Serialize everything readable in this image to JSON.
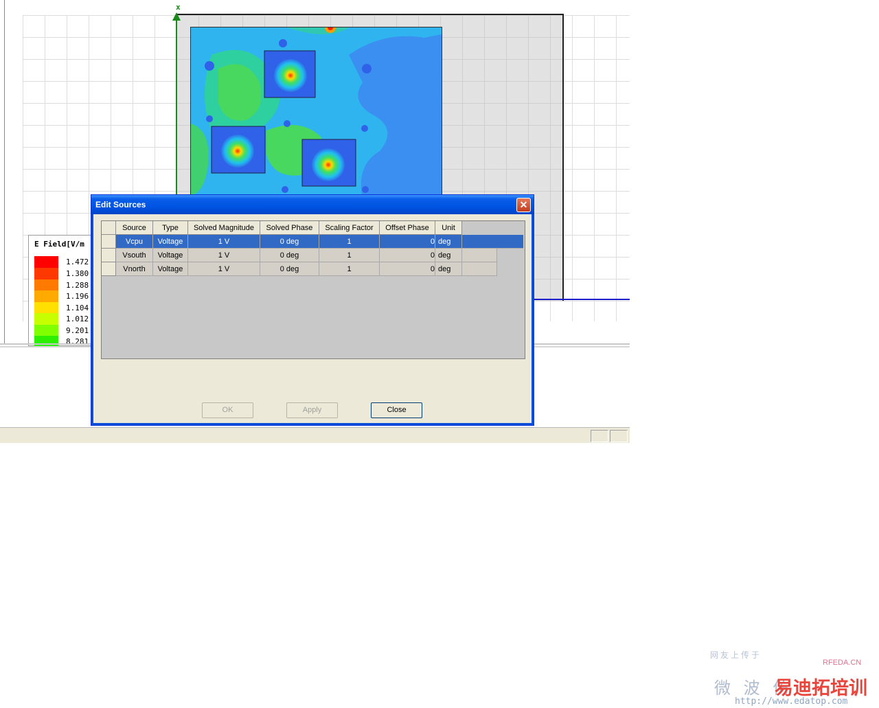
{
  "plot": {
    "axis_label": "x",
    "legend": {
      "title": "E Field[V/m",
      "entries": [
        {
          "value": "1.472",
          "color": "#ff0000"
        },
        {
          "value": "1.380",
          "color": "#ff3800"
        },
        {
          "value": "1.288",
          "color": "#ff7a00"
        },
        {
          "value": "1.196",
          "color": "#ffaa00"
        },
        {
          "value": "1.104",
          "color": "#ffe000"
        },
        {
          "value": "1.012",
          "color": "#c8ff00"
        },
        {
          "value": "9.201",
          "color": "#80ff00"
        },
        {
          "value": "8.281",
          "color": "#2cf000"
        }
      ]
    }
  },
  "dialog": {
    "title": "Edit Sources",
    "close_glyph": "✕",
    "columns": [
      "Source",
      "Type",
      "Solved Magnitude",
      "Solved Phase",
      "Scaling Factor",
      "Offset Phase",
      "Unit"
    ],
    "rows": [
      {
        "source": "Vcpu",
        "type": "Voltage",
        "magnitude": "1 V",
        "phase": "0 deg",
        "scaling": "1",
        "offset": "0",
        "unit": "deg",
        "selected": true
      },
      {
        "source": "Vsouth",
        "type": "Voltage",
        "magnitude": "1 V",
        "phase": "0 deg",
        "scaling": "1",
        "offset": "0",
        "unit": "deg",
        "selected": false
      },
      {
        "source": "Vnorth",
        "type": "Voltage",
        "magnitude": "1 V",
        "phase": "0 deg",
        "scaling": "1",
        "offset": "0",
        "unit": "deg",
        "selected": false
      }
    ],
    "buttons": {
      "ok": "OK",
      "apply": "Apply",
      "close": "Close"
    }
  },
  "watermark": {
    "line1": "网友上传于",
    "rfeda": "RFEDA.CN",
    "line2": "微 波 仿",
    "brand": "易迪拓培训",
    "url": "http://www.edatop.com"
  }
}
